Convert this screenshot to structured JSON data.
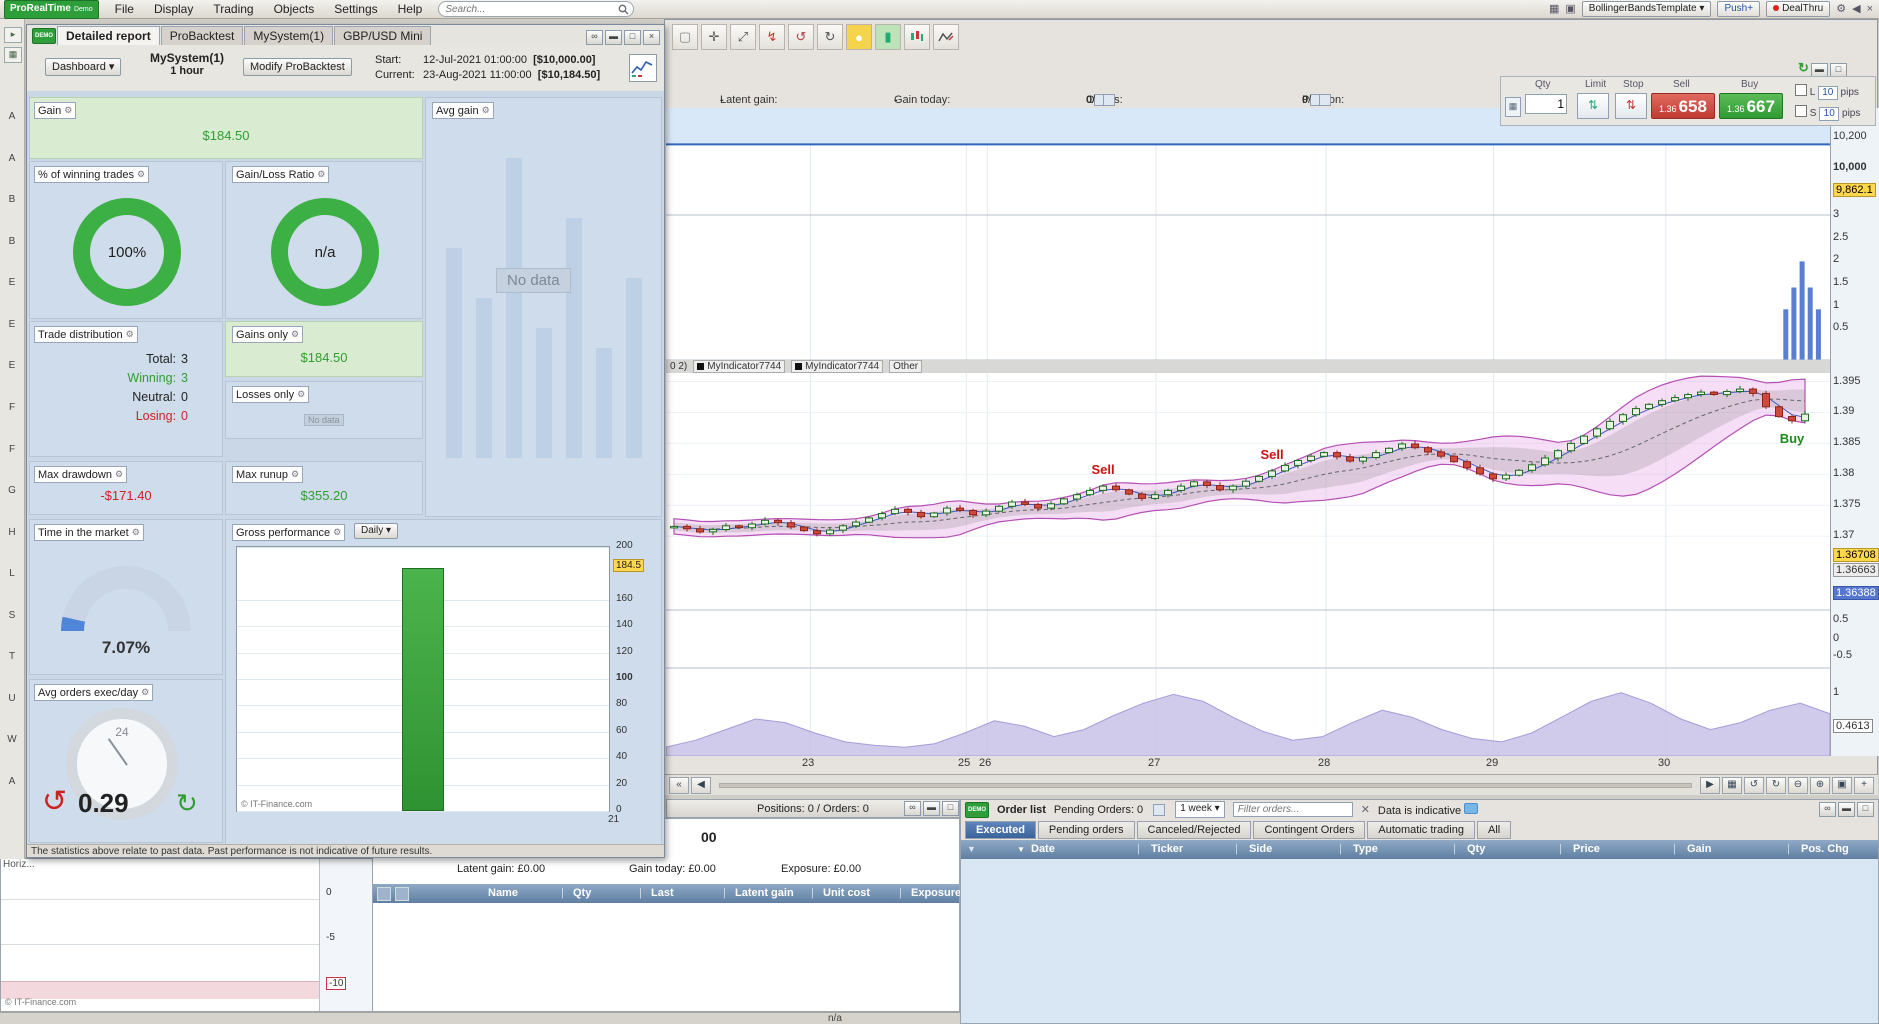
{
  "menubar": {
    "logo_main": "ProRealTime",
    "logo_sub": "Demo",
    "menus": [
      "File",
      "Display",
      "Trading",
      "Objects",
      "Settings",
      "Help"
    ],
    "search_placeholder": "Search...",
    "template_button": "BollingerBandsTemplate",
    "push_button": "Push+",
    "dealthru_button": "DealThru"
  },
  "sidebar": {
    "letters": [
      "A",
      "A",
      "B",
      "B",
      "E",
      "E",
      "E",
      "F",
      "F",
      "G",
      "H",
      "L",
      "S",
      "T",
      "U",
      "W",
      "A"
    ],
    "horiz_label": "Horiz..."
  },
  "report": {
    "tabs": [
      {
        "label": "Detailed report",
        "active": true
      },
      {
        "label": "ProBacktest",
        "active": false
      },
      {
        "label": "MySystem(1)",
        "active": false
      },
      {
        "label": "GBP/USD Mini",
        "active": false
      }
    ],
    "dashboard_button": "Dashboard",
    "system_name": "MySystem(1)",
    "system_timeframe": "1 hour",
    "modify_button": "Modify ProBacktest",
    "start_label": "Start:",
    "start_datetime": "12-Jul-2021 01:00:00",
    "start_equity": "[$10,000.00]",
    "current_label": "Current:",
    "current_datetime": "23-Aug-2021 11:00:00",
    "current_equity": "[$10,184.50]",
    "panels": {
      "gain": {
        "label": "Gain",
        "value": "$184.50"
      },
      "winning": {
        "label": "% of winning trades",
        "value": "100%"
      },
      "ratio": {
        "label": "Gain/Loss Ratio",
        "value": "n/a"
      },
      "avg_gain": {
        "label": "Avg gain",
        "empty": "No data"
      },
      "trade_distribution": {
        "label": "Trade distribution",
        "rows": [
          {
            "name": "Total:",
            "value": "3",
            "color": "#222222"
          },
          {
            "name": "Winning:",
            "value": "3",
            "color": "#2f9e2f"
          },
          {
            "name": "Neutral:",
            "value": "0",
            "color": "#222222"
          },
          {
            "name": "Losing:",
            "value": "0",
            "color": "#cc2222"
          }
        ]
      },
      "gains_only": {
        "label": "Gains only",
        "value": "$184.50"
      },
      "losses_only": {
        "label": "Losses only",
        "empty": "No data"
      },
      "max_drawdown": {
        "label": "Max drawdown",
        "value": "-$171.40"
      },
      "max_runup": {
        "label": "Max runup",
        "value": "$355.20"
      },
      "time_in_market": {
        "label": "Time in the market",
        "value": "7.07%",
        "percent": 7.07
      },
      "avg_orders": {
        "label": "Avg orders exec/day",
        "value": "0.29",
        "clock_top": "24"
      },
      "gross_performance": {
        "label": "Gross performance",
        "period": "Daily",
        "copyright": "© IT-Finance.com"
      }
    },
    "disclaimer": "The statistics above relate to past data. Past performance is not indicative of future results."
  },
  "chart": {
    "info": {
      "latent_label": "Latent gain:",
      "latent_value": "-",
      "today_label": "Gain today:",
      "today_value": "-",
      "orders_label": "Orders:",
      "orders_a": "0",
      "orders_b": "0",
      "position_label": "Position:",
      "position_a": "0",
      "position_b": "0",
      "slash": "/"
    },
    "trade_panel": {
      "qty_label": "Qty",
      "qty": "1",
      "limit_label": "Limit",
      "stop_label": "Stop",
      "sell_label": "Sell",
      "buy_label": "Buy",
      "sell_prefix": "1.36",
      "sell_digits": "658",
      "buy_prefix": "1.36",
      "buy_digits": "667",
      "l_label": "L",
      "s_label": "S",
      "l_value": "10",
      "s_value": "10",
      "pips_label": "pips"
    },
    "legend": {
      "fragment": "0 2)",
      "item1": "MyIndicator7744",
      "item2": "MyIndicator7744",
      "other": "Other"
    },
    "axis_labels": [
      {
        "pane": "eq",
        "frac": 0.27,
        "text": "10,200"
      },
      {
        "pane": "eq",
        "frac": 0.56,
        "text": "10,000",
        "kind": "bold"
      },
      {
        "pane": "eq",
        "frac": 0.77,
        "text": "9,862.1",
        "kind": "yellow"
      },
      {
        "pane": "pos",
        "frac": 0.0,
        "text": "3"
      },
      {
        "pane": "pos",
        "frac": 0.16,
        "text": "2.5"
      },
      {
        "pane": "pos",
        "frac": 0.31,
        "text": "2"
      },
      {
        "pane": "pos",
        "frac": 0.47,
        "text": "1.5"
      },
      {
        "pane": "pos",
        "frac": 0.63,
        "text": "1"
      },
      {
        "pane": "pos",
        "frac": 0.78,
        "text": "0.5"
      },
      {
        "pane": "price",
        "frac": 0.04,
        "text": "1.395"
      },
      {
        "pane": "price",
        "frac": 0.17,
        "text": "1.39"
      },
      {
        "pane": "price",
        "frac": 0.3,
        "text": "1.385"
      },
      {
        "pane": "price",
        "frac": 0.43,
        "text": "1.38"
      },
      {
        "pane": "price",
        "frac": 0.56,
        "text": "1.375"
      },
      {
        "pane": "price",
        "frac": 0.69,
        "text": "1.37"
      },
      {
        "pane": "price",
        "frac": 0.77,
        "text": "1.36708",
        "kind": "yellow"
      },
      {
        "pane": "price",
        "frac": 0.83,
        "text": "1.36663",
        "kind": "gray"
      },
      {
        "pane": "price",
        "frac": 0.93,
        "text": "1.36388",
        "kind": "blue"
      },
      {
        "pane": "aux",
        "frac": 0.18,
        "text": "0.5"
      },
      {
        "pane": "aux",
        "frac": 0.5,
        "text": "0"
      },
      {
        "pane": "aux",
        "frac": 0.8,
        "text": "-0.5"
      },
      {
        "pane": "osc",
        "frac": 0.28,
        "text": "1"
      },
      {
        "pane": "osc",
        "frac": 0.66,
        "text": "0.4613",
        "kind": "box"
      }
    ],
    "x_labels": [
      {
        "frac": 0.124,
        "text": "23"
      },
      {
        "frac": 0.258,
        "text": "25"
      },
      {
        "frac": 0.276,
        "text": "26"
      },
      {
        "frac": 0.421,
        "text": "27"
      },
      {
        "frac": 0.567,
        "text": "28"
      },
      {
        "frac": 0.711,
        "text": "29"
      },
      {
        "frac": 0.859,
        "text": "30"
      }
    ]
  },
  "chart_data": [
    {
      "type": "candlestick",
      "name": "price",
      "y_range": [
        1.3575,
        1.3965
      ],
      "closes": [
        1.3712,
        1.3708,
        1.3703,
        1.3707,
        1.3713,
        1.371,
        1.3716,
        1.3722,
        1.3718,
        1.3711,
        1.3705,
        1.37,
        1.3706,
        1.3713,
        1.3719,
        1.3726,
        1.3733,
        1.374,
        1.3735,
        1.3728,
        1.3734,
        1.3742,
        1.3738,
        1.3731,
        1.3737,
        1.3745,
        1.3752,
        1.3748,
        1.3742,
        1.3749,
        1.3757,
        1.3764,
        1.3771,
        1.3778,
        1.3772,
        1.3765,
        1.3758,
        1.3764,
        1.3771,
        1.3778,
        1.3785,
        1.3779,
        1.3772,
        1.3778,
        1.3786,
        1.3794,
        1.3803,
        1.3812,
        1.382,
        1.3827,
        1.3833,
        1.3826,
        1.3819,
        1.3825,
        1.3833,
        1.384,
        1.3847,
        1.3841,
        1.3834,
        1.3827,
        1.3818,
        1.3808,
        1.3798,
        1.379,
        1.3796,
        1.3804,
        1.3813,
        1.3824,
        1.3836,
        1.3848,
        1.386,
        1.3872,
        1.3884,
        1.3895,
        1.3905,
        1.3912,
        1.3918,
        1.3923,
        1.3928,
        1.3932,
        1.3928,
        1.3933,
        1.3937,
        1.393,
        1.3908,
        1.3892,
        1.3885,
        1.3896
      ],
      "markers": [
        {
          "label": "Sell",
          "index": 33,
          "color": "#cc1111"
        },
        {
          "label": "Sell",
          "index": 46,
          "color": "#cc1111"
        },
        {
          "label": "Buy",
          "index": 86,
          "color": "#1a8a1a"
        }
      ]
    },
    {
      "type": "line",
      "name": "equity",
      "line_frac": 0.34
    },
    {
      "type": "bar",
      "name": "positions-count",
      "bars": [
        {
          "frac": 0.962,
          "h": 0.35
        },
        {
          "frac": 0.969,
          "h": 0.5
        },
        {
          "frac": 0.976,
          "h": 0.68
        },
        {
          "frac": 0.983,
          "h": 0.5
        },
        {
          "frac": 0.99,
          "h": 0.35
        }
      ]
    },
    {
      "type": "area",
      "name": "oscillator",
      "values": [
        0.1,
        0.18,
        0.3,
        0.42,
        0.38,
        0.26,
        0.16,
        0.12,
        0.1,
        0.14,
        0.26,
        0.4,
        0.34,
        0.22,
        0.3,
        0.46,
        0.6,
        0.7,
        0.62,
        0.44,
        0.28,
        0.18,
        0.22,
        0.38,
        0.52,
        0.44,
        0.3,
        0.2,
        0.16,
        0.26,
        0.44,
        0.62,
        0.72,
        0.6,
        0.42,
        0.3,
        0.38,
        0.52,
        0.6,
        0.48
      ]
    },
    {
      "type": "bar",
      "name": "gross-performance",
      "title": "Gross performance",
      "period": "Daily",
      "categories": [
        "21"
      ],
      "values": [
        184.5
      ],
      "ylim": [
        0,
        200
      ],
      "yticks": [
        200,
        160,
        140,
        120,
        100,
        80,
        60,
        40,
        20,
        0
      ],
      "bold_tick": 100,
      "highlight_label": "184.5"
    },
    {
      "type": "line",
      "name": "account-mini",
      "yticks": [
        "0",
        "-5",
        "-10"
      ],
      "highlight": "-10"
    }
  ],
  "positions_bar": {
    "text": "Positions: 0 / Orders: 0"
  },
  "account": {
    "value_fragment": "00",
    "latent": "Latent gain: £0.00",
    "today": "Gain today: £0.00",
    "exposure": "Exposure: £0.00",
    "columns": [
      "Name",
      "Qty",
      "Last",
      "Latent gain",
      "Unit cost",
      "Exposure"
    ],
    "na": "n/a"
  },
  "orders": {
    "title": "Order list",
    "pending": "Pending Orders: 0",
    "period": "1 week",
    "filter_placeholder": "Filter orders...",
    "indicative": "Data is indicative",
    "tabs": [
      {
        "label": "Executed",
        "active": true
      },
      {
        "label": "Pending orders",
        "active": false
      },
      {
        "label": "Canceled/Rejected",
        "active": false
      },
      {
        "label": "Contingent Orders",
        "active": false
      },
      {
        "label": "Automatic trading",
        "active": false
      },
      {
        "label": "All",
        "active": false
      }
    ],
    "columns": [
      "Date",
      "Ticker",
      "Side",
      "Type",
      "Qty",
      "Price",
      "Gain",
      "Pos. Chg"
    ]
  },
  "mini": {
    "copyright": "© IT-Finance.com"
  }
}
